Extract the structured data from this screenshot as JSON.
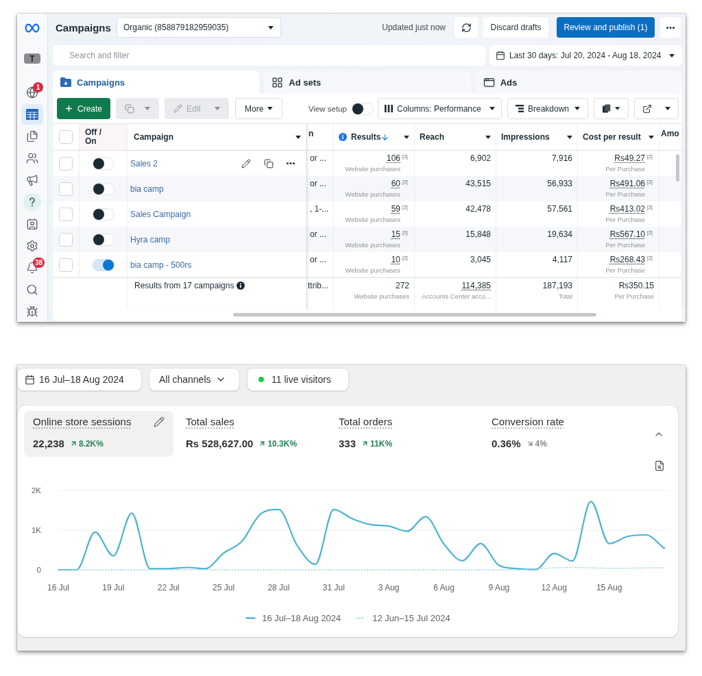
{
  "sidebar": {
    "avatar": "T",
    "items": [
      {
        "selected": false,
        "badge": "1"
      },
      {
        "selected": true
      },
      {
        "selected": false
      },
      {
        "selected": false
      },
      {
        "selected": false
      },
      {
        "selected": false
      },
      {
        "selected": false
      },
      {
        "selected": false
      },
      {
        "selected": false,
        "badge": "38"
      },
      {
        "selected": false
      },
      {
        "selected": false
      }
    ]
  },
  "header": {
    "title": "Campaigns",
    "account": "Organic (858879182959035)",
    "status": "Updated just now",
    "buttons": [
      {
        "label": "Discard drafts",
        "kind": "secondary"
      },
      {
        "label": "Review and publish (1)",
        "kind": "primary"
      }
    ]
  },
  "search": {
    "placeholder": "Search and filter"
  },
  "date_range": "Last 30 days: Jul 20, 2024 - Aug 18, 2024",
  "tabs": [
    {
      "label": "Campaigns",
      "selected": true
    },
    {
      "label": "Ad sets",
      "selected": false
    },
    {
      "label": "Ads",
      "selected": false
    }
  ],
  "toolbar": {
    "create": {
      "label": "Create"
    },
    "duplicate": {
      "disabled": true
    },
    "edit": {
      "label": "Edit",
      "disabled": true
    },
    "more": {
      "label": "More"
    },
    "view_setup": {
      "label": "View setup",
      "on": false
    },
    "columns": {
      "label": "Columns: Performance"
    },
    "breakdown": {
      "label": "Breakdown"
    }
  },
  "table": {
    "header_checked": false,
    "columns": [
      {
        "label": "Off / On",
        "kind": "toggle",
        "sorted": false,
        "info": false
      },
      {
        "label": "Campaign",
        "kind": "name",
        "sorted": false,
        "info": false
      },
      {
        "label": "n",
        "kind": "cut",
        "sorted": false,
        "info": false
      },
      {
        "label": "Results",
        "kind": "metric",
        "sorted": true,
        "info": true
      },
      {
        "label": "Reach",
        "kind": "metric",
        "sorted": false,
        "info": false
      },
      {
        "label": "Impressions",
        "kind": "metric",
        "sorted": false,
        "info": false
      },
      {
        "label": "Cost per result",
        "kind": "metric",
        "sorted": false,
        "info": false
      },
      {
        "label": "Amo",
        "kind": "cut",
        "sorted": false,
        "info": false
      }
    ],
    "rows": [
      {
        "checked": false,
        "on": false,
        "hovered": true,
        "name": "Sales 2",
        "column_4": "or ...",
        "results": {
          "value": "106",
          "note": "[2]",
          "unit": "Website purchases"
        },
        "reach": "6,902",
        "impressions": "7,916",
        "cost": {
          "value": "Rs49.27",
          "note": "[2]",
          "unit": "Per Purchase"
        }
      },
      {
        "checked": false,
        "on": false,
        "hovered": false,
        "name": "bia camp",
        "column_4": "or ...",
        "results": {
          "value": "60",
          "note": "[2]",
          "unit": "Website purchases"
        },
        "reach": "43,515",
        "impressions": "56,933",
        "cost": {
          "value": "Rs491.06",
          "note": "[2]",
          "unit": "Per Purchase"
        }
      },
      {
        "checked": false,
        "on": false,
        "hovered": false,
        "name": "Sales Campaign",
        "column_4": ", 1-...",
        "results": {
          "value": "59",
          "note": "[2]",
          "unit": "Website purchases"
        },
        "reach": "42,478",
        "impressions": "57,561",
        "cost": {
          "value": "Rs413.02",
          "note": "[2]",
          "unit": "Per Purchase"
        }
      },
      {
        "checked": false,
        "on": false,
        "hovered": false,
        "name": "Hyra camp",
        "column_4": "or ...",
        "results": {
          "value": "15",
          "note": "[2]",
          "unit": "Website purchases"
        },
        "reach": "15,848",
        "impressions": "19,634",
        "cost": {
          "value": "Rs567.10",
          "note": "[2]",
          "unit": "Per Purchase"
        }
      },
      {
        "checked": false,
        "on": true,
        "hovered": false,
        "name": "bia camp - 500rs",
        "column_4": "or ...",
        "results": {
          "value": "10",
          "note": "[2]",
          "unit": "Website purchases"
        },
        "reach": "3,045",
        "impressions": "4,117",
        "cost": {
          "value": "Rs268.43",
          "note": "[2]",
          "unit": "Per Purchase"
        }
      }
    ],
    "footer": {
      "label": "Results from 17 campaigns",
      "column_4": "ttrib...",
      "results": {
        "value": "272",
        "unit": "Website purchases",
        "underlined": false
      },
      "reach": {
        "value": "114,385",
        "unit": "Accounts Center acco...",
        "underlined": true
      },
      "impressions": {
        "value": "187,193",
        "unit": "Total",
        "underlined": false
      },
      "cost": {
        "value": "Rs350.15",
        "unit": "Per Purchase",
        "underlined": false
      }
    }
  },
  "analytics": {
    "date": "16 Jul–18 Aug 2024",
    "channels": "All channels",
    "live": "11 live visitors",
    "metrics": [
      {
        "label": "Online store sessions",
        "value": "22,238",
        "change": "8.2K%",
        "rising": true,
        "selected": true
      },
      {
        "label": "Total sales",
        "value": "Rs 528,627.00",
        "change": "10.3K%",
        "rising": true,
        "selected": false
      },
      {
        "label": "Total orders",
        "value": "333",
        "change": "11K%",
        "rising": true,
        "selected": false
      },
      {
        "label": "Conversion rate",
        "value": "0.36%",
        "change": "4%",
        "rising": false,
        "selected": false
      }
    ],
    "chart_data": {
      "type": "line",
      "categories": [
        "16 Jul",
        null,
        null,
        "19 Jul",
        null,
        null,
        "22 Jul",
        null,
        null,
        "25 Jul",
        null,
        null,
        "28 Jul",
        null,
        null,
        "31 Jul",
        null,
        null,
        "3 Aug",
        null,
        null,
        "6 Aug",
        null,
        null,
        "9 Aug",
        null,
        null,
        "12 Aug",
        null,
        null,
        "15 Aug",
        null,
        null,
        null
      ],
      "ylim": [
        0,
        2000
      ],
      "yticks": [
        {
          "value": 0,
          "label": "0"
        },
        {
          "value": 1000,
          "label": "1K"
        },
        {
          "value": 2000,
          "label": "2K"
        }
      ],
      "series": [
        {
          "name": "16 Jul–18 Aug 2024",
          "color": "#4db4d0",
          "line_style": "solid",
          "values": [
            0,
            0,
            950,
            350,
            1430,
            30,
            30,
            60,
            30,
            420,
            720,
            1400,
            1520,
            620,
            140,
            1520,
            1290,
            1140,
            1100,
            970,
            1340,
            650,
            230,
            660,
            110,
            30,
            10,
            410,
            220,
            1720,
            660,
            840,
            880,
            540
          ]
        },
        {
          "name": "12 Jun–15 Jul 2024",
          "color": "#9fd3e6",
          "line_style": "dotted",
          "values": [
            0,
            0,
            0,
            0,
            0,
            0,
            0,
            0,
            0,
            0,
            0,
            0,
            0,
            0,
            0,
            0,
            0,
            0,
            0,
            0,
            0,
            0,
            0,
            0,
            0,
            0,
            30,
            50,
            60,
            50,
            40,
            40,
            50,
            50
          ]
        }
      ]
    }
  }
}
